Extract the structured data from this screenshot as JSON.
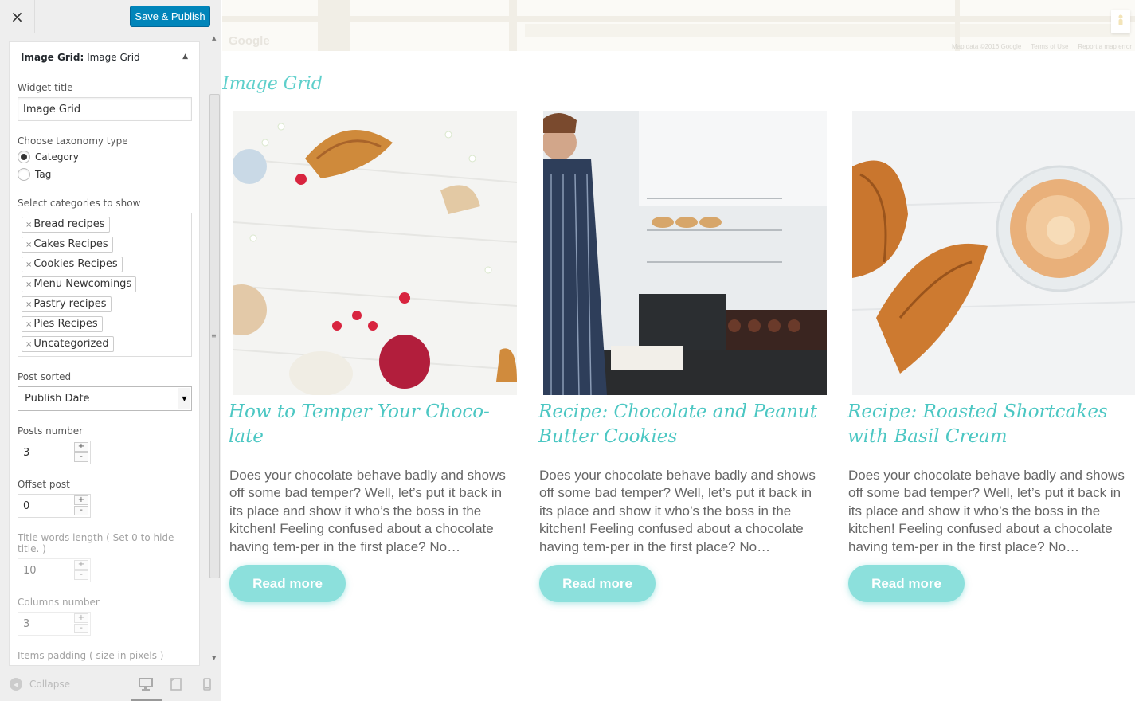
{
  "topbar": {
    "close_icon": "×",
    "save_label": "Save & Publish"
  },
  "panel": {
    "header_bold": "Image Grid:",
    "header_rest": " Image Grid",
    "arrow": "▲",
    "widget_title_label": "Widget title",
    "widget_title_value": "Image Grid",
    "taxonomy_label": "Choose taxonomy type",
    "taxonomy_options": [
      "Category",
      "Tag"
    ],
    "taxonomy_selected": "Category",
    "categories_label": "Select categories to show",
    "categories": [
      "Bread recipes",
      "Cakes Recipes",
      "Cookies Recipes",
      "Menu Newcomings",
      "Pastry recipes",
      "Pies Recipes",
      "Uncategorized"
    ],
    "chip_remove": "×",
    "sorted_label": "Post sorted",
    "sorted_value": "Publish Date",
    "sorted_caret": "▼",
    "posts_number_label": "Posts number",
    "posts_number_value": "3",
    "offset_label": "Offset post",
    "offset_value": "0",
    "title_words_label": "Title words length ( Set 0 to hide title. )",
    "title_words_value": "10",
    "columns_label": "Columns number",
    "columns_value": "3",
    "padding_label": "Items padding ( size in pixels )",
    "spin_up": "+",
    "spin_down": "-"
  },
  "scrollbar": {
    "up": "▲",
    "down": "▼",
    "grip": "≡"
  },
  "footer": {
    "collapse_icon": "◀",
    "collapse_label": "Collapse"
  },
  "map": {
    "google_label": "Google",
    "credits": [
      "Map data ©2016 Google",
      "Terms of Use",
      "Report a map error"
    ]
  },
  "grid": {
    "title": "Image Grid",
    "posts": [
      {
        "title": "How to Temper Your Choco-late",
        "excerpt": "Does your chocolate behave badly and shows off some bad temper? Well, let’s put it back in its place and show it who’s the boss in the kitchen! Feeling confused about a chocolate having tem-per in the first place? No…",
        "button": "Read more"
      },
      {
        "title": "Recipe: Chocolate and Peanut Butter Cookies",
        "excerpt": "Does your chocolate behave badly and shows off some bad temper? Well, let’s put it back in its place and show it who’s the boss in the kitchen! Feeling confused about a chocolate having tem-per in the first place? No…",
        "button": "Read more"
      },
      {
        "title": "Recipe: Roasted Shortcakes with Basil Cream",
        "excerpt": "Does your chocolate behave badly and shows off some bad temper? Well, let’s put it back in its place and show it who’s the boss in the kitchen! Feeling confused about a chocolate having tem-per in the first place? No…",
        "button": "Read more"
      }
    ]
  },
  "colors": {
    "accent": "#4cc7c3",
    "button": "#8ce0dc",
    "save": "#0085ba"
  }
}
